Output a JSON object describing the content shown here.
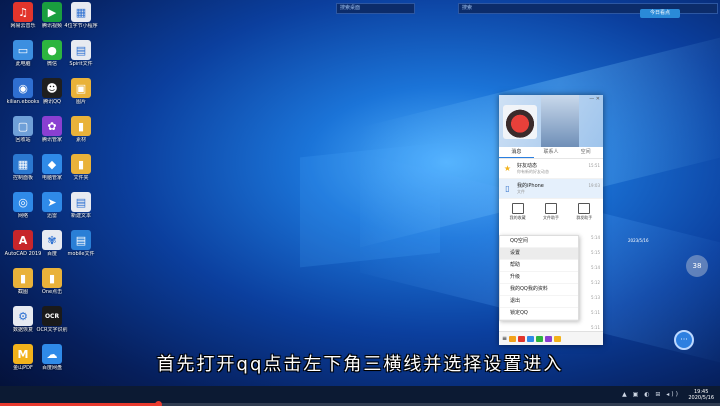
{
  "desktop": {
    "icons": [
      {
        "label": "网易云音乐",
        "glyph": "♫",
        "color": "#e2352c",
        "col": 0,
        "row": 0
      },
      {
        "label": "腾讯视频",
        "glyph": "▶",
        "color": "#1a9e3f",
        "col": 1,
        "row": 0
      },
      {
        "label": "4位字节小程序",
        "glyph": "▦",
        "color": "#e7eaf1",
        "col": 2,
        "row": 0
      },
      {
        "label": "此电脑",
        "glyph": "▭",
        "color": "#3c8fe0",
        "col": 0,
        "row": 1
      },
      {
        "label": "微信",
        "glyph": "●",
        "color": "#2db53f",
        "col": 1,
        "row": 1
      },
      {
        "label": "Spirit文件",
        "glyph": "▤",
        "color": "#e7eaf1",
        "col": 2,
        "row": 1
      },
      {
        "label": "kilian.ebooks",
        "glyph": "◉",
        "color": "#2f6fd1",
        "col": 0,
        "row": 2
      },
      {
        "label": "腾讯QQ",
        "glyph": "☻",
        "color": "#1f1f1f",
        "col": 1,
        "row": 2
      },
      {
        "label": "图片",
        "glyph": "▣",
        "color": "#e9b23a",
        "col": 2,
        "row": 2
      },
      {
        "label": "回收站",
        "glyph": "▢",
        "color": "#6fa0d8",
        "col": 0,
        "row": 3
      },
      {
        "label": "腾讯管家",
        "glyph": "✿",
        "color": "#8a3fd1",
        "col": 1,
        "row": 3
      },
      {
        "label": "素材",
        "glyph": "▮",
        "color": "#e9b23a",
        "col": 2,
        "row": 3
      },
      {
        "label": "控制面板",
        "glyph": "▦",
        "color": "#2b78d0",
        "col": 0,
        "row": 4
      },
      {
        "label": "电脑管家",
        "glyph": "◆",
        "color": "#2f8ae8",
        "col": 1,
        "row": 4
      },
      {
        "label": "文件夹",
        "glyph": "▮",
        "color": "#e9b23a",
        "col": 2,
        "row": 4
      },
      {
        "label": "网络",
        "glyph": "◎",
        "color": "#2f8ae8",
        "col": 0,
        "row": 5
      },
      {
        "label": "迅雷",
        "glyph": "➤",
        "color": "#2f8ae8",
        "col": 1,
        "row": 5
      },
      {
        "label": "新建文本",
        "glyph": "▤",
        "color": "#e7eaf1",
        "col": 2,
        "row": 5
      },
      {
        "label": "AutoCAD 2019",
        "glyph": "A",
        "color": "#c7262b",
        "col": 0,
        "row": 6
      },
      {
        "label": "百度",
        "glyph": "✾",
        "color": "#e7eaf1",
        "col": 1,
        "row": 6
      },
      {
        "label": "mobile文件",
        "glyph": "▤",
        "color": "#2a7fd6",
        "col": 2,
        "row": 6
      },
      {
        "label": "截图",
        "glyph": "▮",
        "color": "#e9b23a",
        "col": 0,
        "row": 7
      },
      {
        "label": "One点击",
        "glyph": "▮",
        "color": "#e9b23a",
        "col": 1,
        "row": 7
      },
      {
        "label": "数据恢复",
        "glyph": "⚙",
        "color": "#e7eaf1",
        "col": 0,
        "row": 8
      },
      {
        "label": "OCR文字识别",
        "glyph": "OCR",
        "color": "#1a1a1a",
        "col": 1,
        "row": 8
      },
      {
        "label": "金山PDF",
        "glyph": "M",
        "color": "#f2b21b",
        "col": 0,
        "row": 9
      },
      {
        "label": "百度网盘",
        "glyph": "☁",
        "color": "#2f8ae8",
        "col": 1,
        "row": 9
      }
    ],
    "search_left": "搜索桌面",
    "search_right": "搜索",
    "top_button": "今日看点"
  },
  "qq": {
    "tabs": [
      "消息",
      "联系人",
      "空间"
    ],
    "rows": [
      {
        "title": "好友动态",
        "sub": "你有新的好友动态",
        "time": "15:51",
        "icon": "★"
      },
      {
        "title": "我的iPhone",
        "sub": "文件",
        "time": "19:03",
        "icon": "▯"
      }
    ],
    "shortcuts": [
      "我的收藏",
      "文件助手",
      "群发助手"
    ],
    "menu": [
      "QQ空间",
      "设置",
      "帮助",
      "升级",
      "我的QQ我的资料",
      "退出",
      "锁定QQ"
    ],
    "times": [
      "5:14",
      "5:15",
      "5:14",
      "5:12",
      "5:13",
      "5:11",
      "5:11"
    ],
    "bottom_label": "≡"
  },
  "widget": {
    "text": "2023/5/16",
    "badge": "38"
  },
  "subtitle": "首先打开qq点击左下角三横线并选择设置进入",
  "taskbar": {
    "time": "19:45",
    "date": "2020/5/16"
  },
  "video_progress": 0.22
}
